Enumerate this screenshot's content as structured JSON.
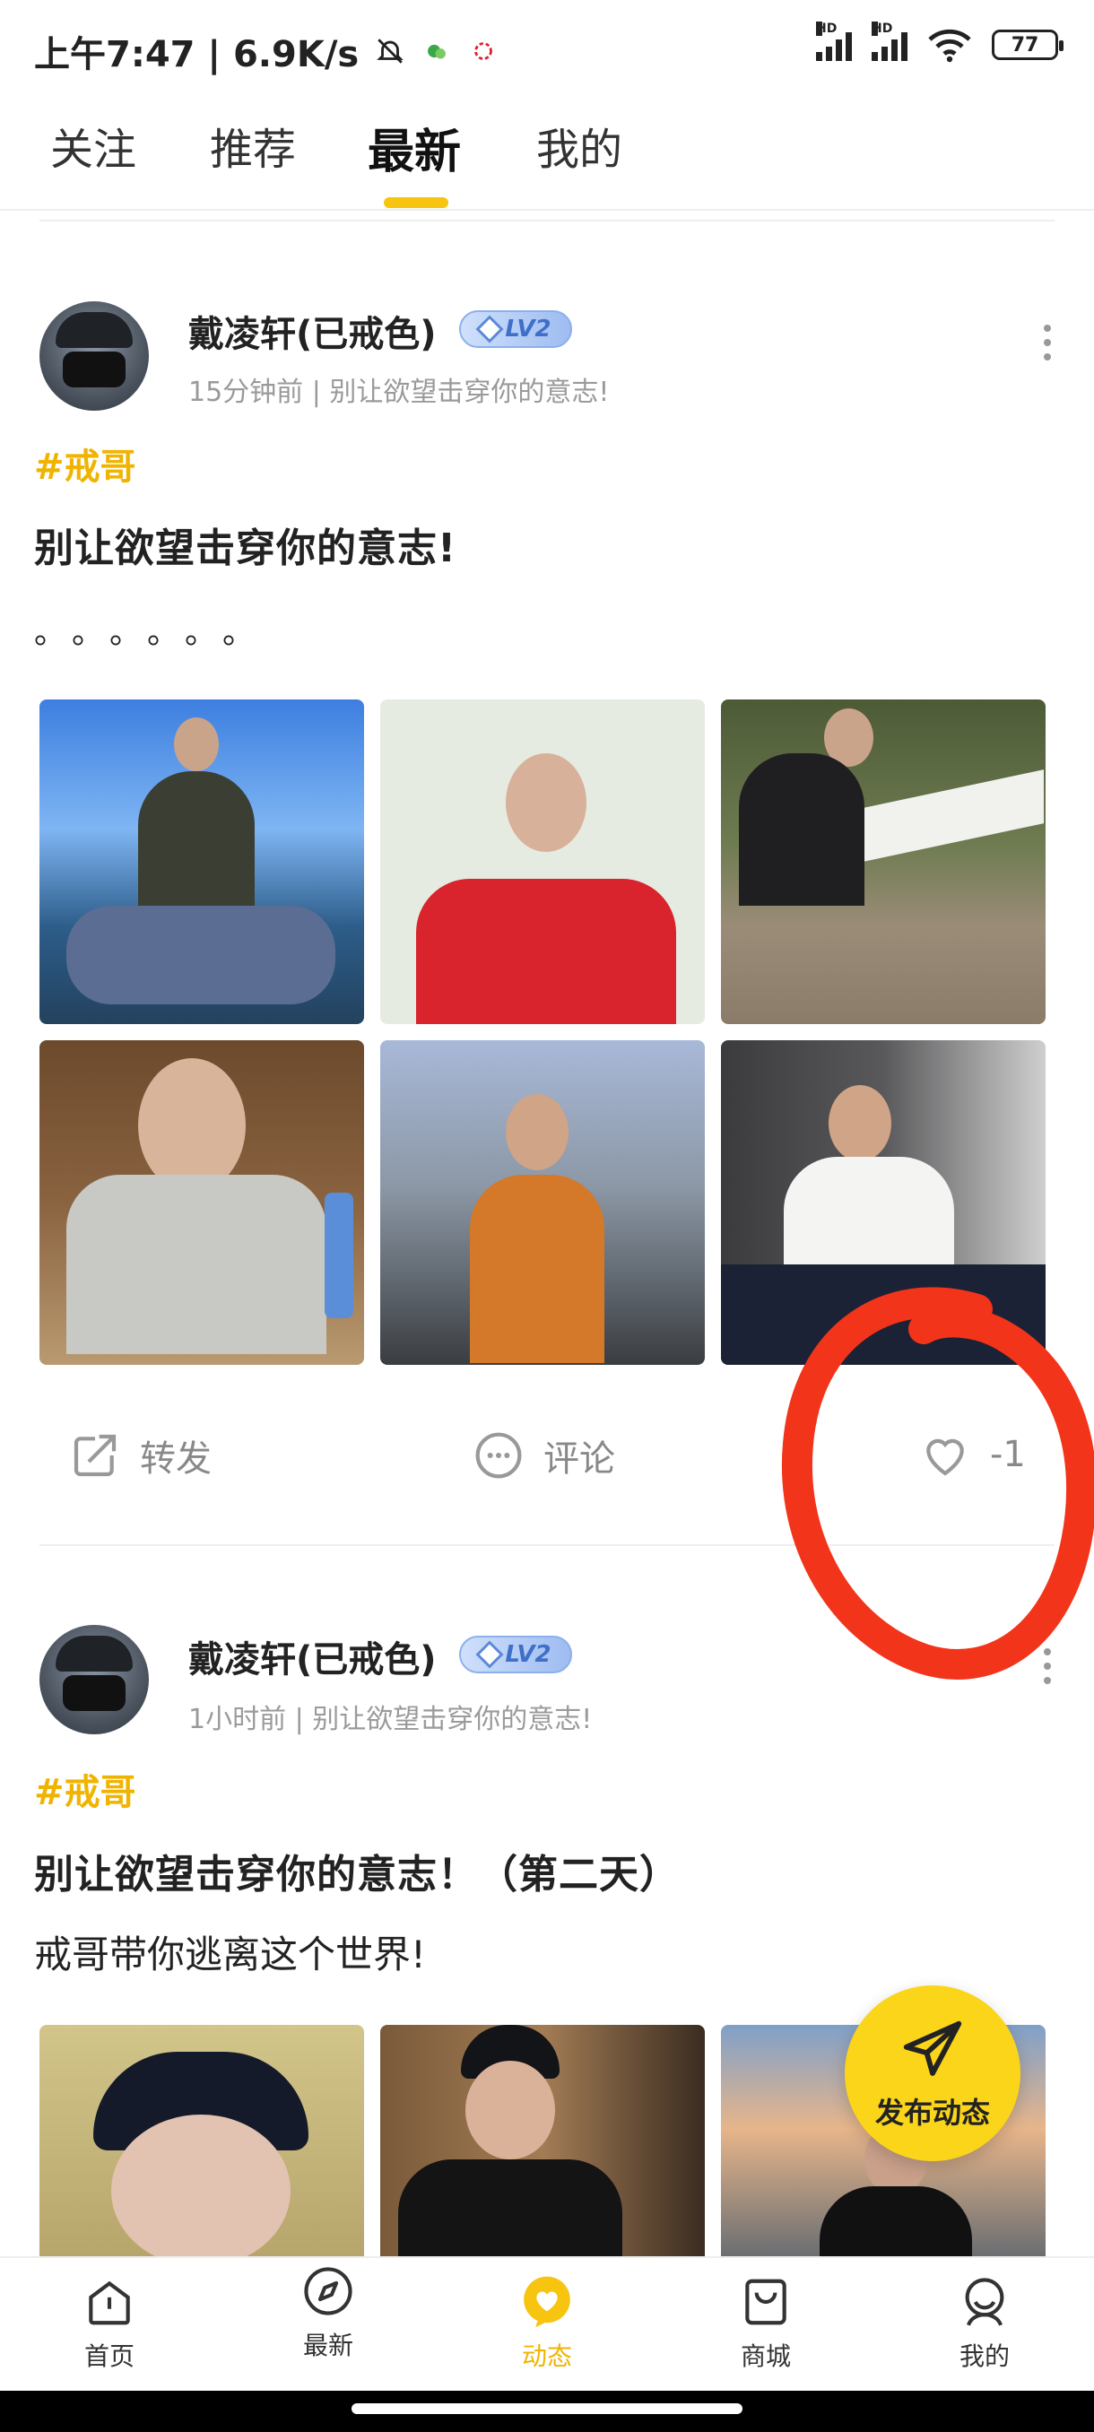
{
  "status_bar": {
    "time": "上午7:47",
    "speed": "6.9K/s",
    "network_label": "HD",
    "battery": "77"
  },
  "tabs": [
    {
      "label": "关注"
    },
    {
      "label": "推荐"
    },
    {
      "label": "最新"
    },
    {
      "label": "我的"
    }
  ],
  "posts": [
    {
      "username": "戴凌轩(已戒色)",
      "level": "LV2",
      "time": "15分钟前",
      "sub": "别让欲望击穿你的意志!",
      "topic": "#戒哥",
      "title": "别让欲望击穿你的意志!",
      "body": "。。。。。。",
      "actions": {
        "repost": "转发",
        "comment": "评论",
        "likes": "-1"
      }
    },
    {
      "username": "戴凌轩(已戒色)",
      "level": "LV2",
      "time": "1小时前",
      "sub": "别让欲望击穿你的意志!",
      "topic": "#戒哥",
      "title": "别让欲望击穿你的意志！（第二天）",
      "body": "戒哥带你逃离这个世界!"
    }
  ],
  "fab": {
    "label": "发布动态"
  },
  "bottom_nav": [
    {
      "label": "首页",
      "icon": "home-icon"
    },
    {
      "label": "最新",
      "icon": "compass-icon"
    },
    {
      "label": "动态",
      "icon": "heart-bubble-icon"
    },
    {
      "label": "商城",
      "icon": "shopping-bag-icon"
    },
    {
      "label": "我的",
      "icon": "profile-icon"
    }
  ],
  "colors": {
    "accent": "#f7c410",
    "topic": "#f0b400",
    "annotation": "#f2341a",
    "level_badge": "#3f6fc9"
  }
}
